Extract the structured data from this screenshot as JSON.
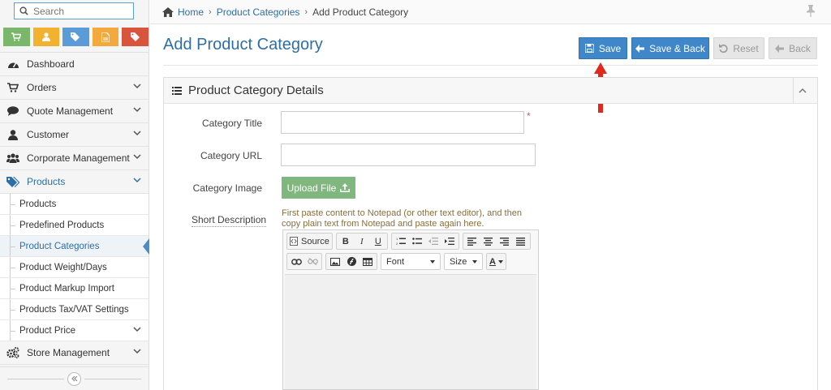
{
  "sidebar": {
    "search_placeholder": "Search",
    "shortcuts": [
      "cart-icon",
      "user-icon",
      "tags-icon",
      "document-icon",
      "tag-icon"
    ],
    "menu": [
      {
        "label": "Dashboard",
        "icon": "dashboard-icon"
      },
      {
        "label": "Orders",
        "icon": "cart-icon"
      },
      {
        "label": "Quote Management",
        "icon": "comment-icon"
      },
      {
        "label": "Customer",
        "icon": "user-icon"
      },
      {
        "label": "Corporate Management",
        "icon": "users-icon"
      },
      {
        "label": "Products",
        "icon": "tags-icon"
      }
    ],
    "products_sub": [
      {
        "label": "Products"
      },
      {
        "label": "Predefined Products"
      },
      {
        "label": "Product Categories"
      },
      {
        "label": "Product Weight/Days"
      },
      {
        "label": "Product Markup Import"
      },
      {
        "label": "Products Tax/VAT Settings"
      },
      {
        "label": "Product Price"
      }
    ],
    "store": {
      "label": "Store Management",
      "icon": "cogs-icon"
    }
  },
  "breadcrumb": {
    "home": "Home",
    "section": "Product Categories",
    "current": "Add Product Category"
  },
  "page": {
    "title": "Add Product Category"
  },
  "actions": {
    "save": "Save",
    "save_back": "Save & Back",
    "reset": "Reset",
    "back": "Back"
  },
  "panel": {
    "title": "Product Category Details"
  },
  "form": {
    "category_title_label": "Category Title",
    "category_title_value": "",
    "category_url_label": "Category URL",
    "category_url_value": "",
    "category_image_label": "Category Image",
    "upload_label": "Upload File",
    "short_description_label": "Short Description",
    "hint": "First paste content to Notepad (or other text editor), and then copy plain text from Notepad and paste again here.",
    "required_mark": "*"
  },
  "editor": {
    "source": "Source",
    "bold": "B",
    "italic": "I",
    "underline": "U",
    "font": "Font",
    "size": "Size",
    "text_color": "A"
  },
  "colors": {
    "accent": "#3f87c9",
    "upload": "#7fb77e",
    "required": "#d9534f",
    "arrow": "#e0281d"
  }
}
